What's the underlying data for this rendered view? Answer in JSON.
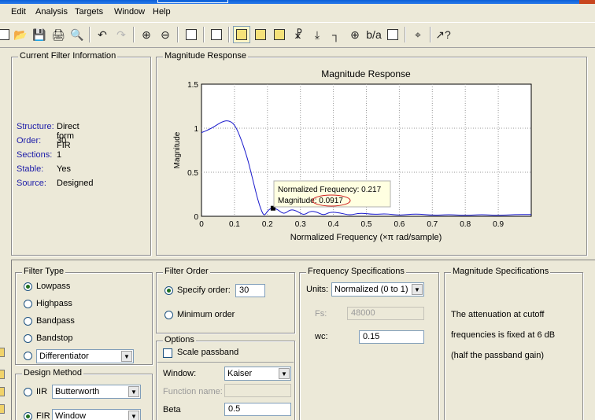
{
  "menu": [
    "Edit",
    "Analysis",
    "Targets",
    "Window",
    "Help"
  ],
  "toolbar": {
    "icons": [
      "new-icon",
      "open-icon",
      "save-icon",
      "print-icon",
      "print-preview-icon",
      "undo-icon",
      "redo-icon",
      "zoom-in-icon",
      "zoom-out-icon",
      "full-view-icon",
      "filter-specs-icon",
      "magnitude-response-icon",
      "phase-response-icon",
      "magnitude-phase-icon",
      "group-delay-icon",
      "impulse-response-icon",
      "step-response-icon",
      "pole-zero-icon",
      "coefficients-icon",
      "filter-info-icon",
      "data-markers-icon",
      "whats-this-icon"
    ]
  },
  "current_filter": {
    "legend": "Current Filter Information",
    "rows": [
      {
        "key": "Structure:",
        "value": "Direct form FIR"
      },
      {
        "key": "Order:",
        "value": "30"
      },
      {
        "key": "Sections:",
        "value": "1"
      },
      {
        "key": "Stable:",
        "value": "Yes"
      },
      {
        "key": "Source:",
        "value": "Designed"
      }
    ]
  },
  "magnitude_panel": {
    "legend": "Magnitude Response"
  },
  "chart_data": {
    "type": "line",
    "title": "Magnitude Response",
    "xlabel": "Normalized Frequency  (×π rad/sample)",
    "ylabel": "Magnitude",
    "xlim": [
      0,
      1
    ],
    "ylim": [
      0,
      1.5
    ],
    "xticks": [
      "0",
      "0.1",
      "0.2",
      "0.3",
      "0.4",
      "0.5",
      "0.6",
      "0.7",
      "0.8",
      "0.9"
    ],
    "yticks": [
      "0",
      "0.5",
      "1",
      "1.5"
    ],
    "grid": true,
    "color": "#1a1acc",
    "x": [
      0,
      0.02,
      0.04,
      0.06,
      0.08,
      0.1,
      0.12,
      0.14,
      0.15,
      0.16,
      0.17,
      0.18,
      0.19,
      0.2,
      0.21,
      0.217,
      0.23,
      0.25,
      0.27,
      0.29,
      0.31,
      0.33,
      0.35,
      0.37,
      0.39,
      0.42,
      0.45,
      0.48,
      0.52,
      0.56,
      0.6,
      0.65,
      0.7,
      0.75,
      0.8,
      0.85,
      0.9,
      0.95,
      1.0
    ],
    "y": [
      0.95,
      0.98,
      1.02,
      1.07,
      1.09,
      1.05,
      0.88,
      0.65,
      0.5,
      0.35,
      0.2,
      0.08,
      0.0,
      0.06,
      0.09,
      0.0917,
      0.08,
      0.02,
      0.08,
      0.06,
      0.01,
      0.06,
      0.05,
      0.01,
      0.05,
      0.04,
      0.01,
      0.04,
      0.02,
      0.03,
      0.01,
      0.03,
      0.01,
      0.02,
      0.01,
      0.02,
      0.01,
      0.02,
      0.02
    ],
    "datatip": {
      "x": 0.217,
      "y": 0.0917,
      "line1": "Normalized Frequency: 0.217",
      "line2_label": "Magnitude",
      "line2_value": ": 0.0917"
    }
  },
  "filter_type": {
    "legend": "Filter Type",
    "options": [
      "Lowpass",
      "Highpass",
      "Bandpass",
      "Bandstop"
    ],
    "selected": "Lowpass",
    "other_value": "Differentiator"
  },
  "design_method": {
    "legend": "Design Method",
    "iir_label": "IIR",
    "iir_value": "Butterworth",
    "fir_label": "FIR",
    "fir_value": "Window"
  },
  "filter_order": {
    "legend": "Filter Order",
    "specify_label": "Specify order:",
    "specify_value": "30",
    "minimum_label": "Minimum order"
  },
  "options": {
    "legend": "Options",
    "scale_passband": "Scale passband",
    "window_label": "Window:",
    "window_value": "Kaiser",
    "function_label": "Function name:",
    "beta_label": "Beta",
    "beta_value": "0.5"
  },
  "freq_specs": {
    "legend": "Frequency Specifications",
    "units_label": "Units:",
    "units_value": "Normalized (0 to 1)",
    "fs_label": "Fs:",
    "fs_value": "48000",
    "wc_label": "wc:",
    "wc_value": "0.15"
  },
  "mag_specs": {
    "legend": "Magnitude Specifications",
    "line1": "The attenuation at cutoff",
    "line2": "frequencies is fixed at 6 dB",
    "line3": "(half the passband gain)"
  }
}
